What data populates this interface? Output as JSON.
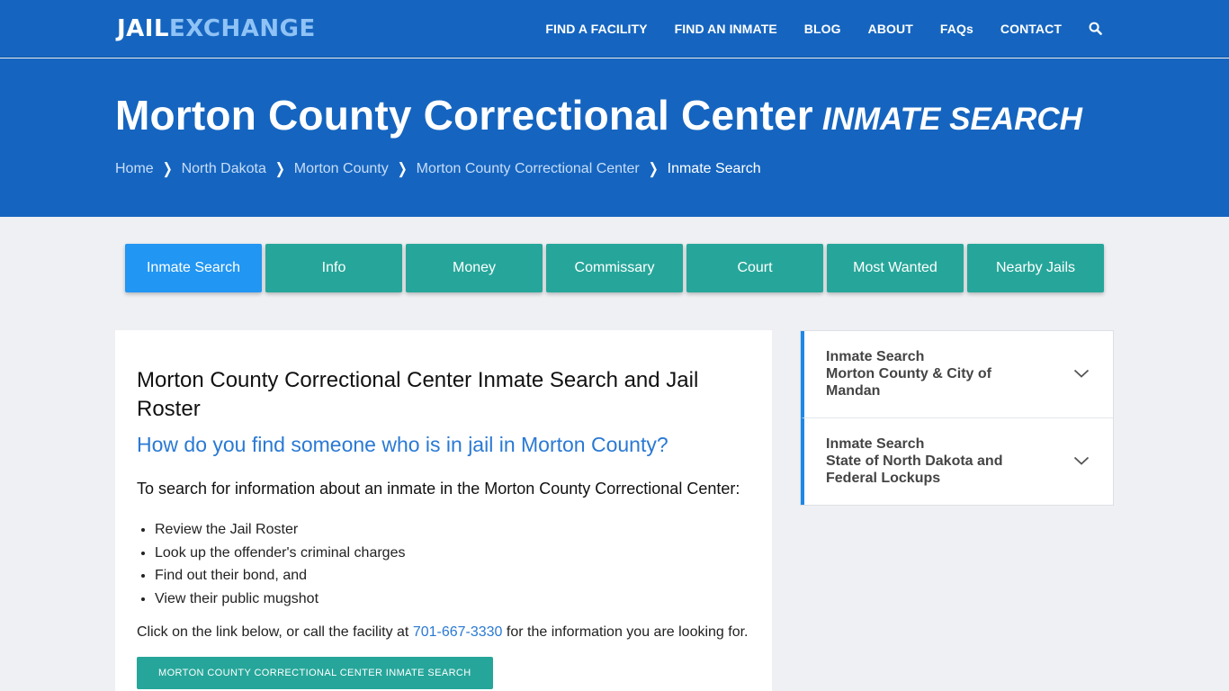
{
  "brand": {
    "part1": "JAIL",
    "part2": "EXCHANGE"
  },
  "nav": {
    "items": [
      "FIND A FACILITY",
      "FIND AN INMATE",
      "BLOG",
      "ABOUT",
      "FAQs",
      "CONTACT"
    ],
    "search_icon": "search-icon"
  },
  "hero": {
    "title": "Morton County Correctional Center",
    "subtitle": "INMATE SEARCH",
    "breadcrumbs": [
      "Home",
      "North Dakota",
      "Morton County",
      "Morton County Correctional Center"
    ],
    "breadcrumb_current": "Inmate Search"
  },
  "tabs": [
    "Inmate Search",
    "Info",
    "Money",
    "Commissary",
    "Court",
    "Most Wanted",
    "Nearby Jails"
  ],
  "main": {
    "heading": "Morton County Correctional Center Inmate Search and Jail Roster",
    "question": "How do you find someone who is in jail in Morton County?",
    "intro": "To search for information about an inmate in the Morton County Correctional Center:",
    "bullets": [
      "Review the Jail Roster",
      "Look up the offender's criminal charges",
      "Find out their bond, and",
      "View their public mugshot"
    ],
    "call_before": "Click on the link below, or call the facility at ",
    "phone": "701-667-3330",
    "call_after": " for the information you are looking for.",
    "cta": "MORTON COUNTY CORRECTIONAL CENTER INMATE SEARCH"
  },
  "sidebar": {
    "items": [
      {
        "line1": "Inmate Search",
        "line2": "Morton County & City of Mandan"
      },
      {
        "line1": "Inmate Search",
        "line2": "State of North Dakota and Federal Lockups"
      }
    ]
  },
  "colors": {
    "header_blue": "#1565c0",
    "tab_teal": "#26a69a",
    "tab_active": "#2196f3",
    "link_blue": "#2a79d4"
  }
}
